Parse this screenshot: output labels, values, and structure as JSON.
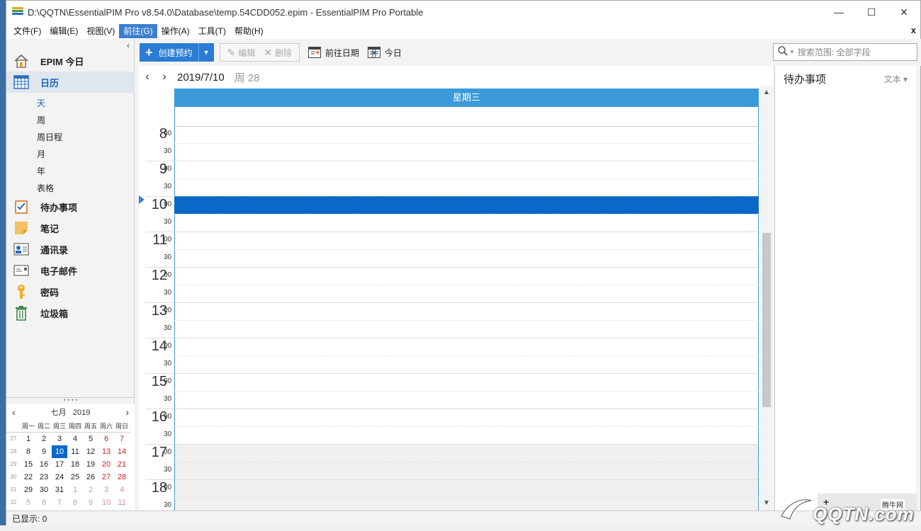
{
  "window": {
    "title": "D:\\QQTN\\EssentialPIM Pro v8.54.0\\Database\\temp.54CDD052.epim - EssentialPIM Pro Portable",
    "minimize": "—",
    "maximize": "☐",
    "close": "✕"
  },
  "menubar": {
    "items": [
      "文件(F)",
      "编辑(E)",
      "视图(V)",
      "前往(G)",
      "操作(A)",
      "工具(T)",
      "帮助(H)"
    ],
    "active_index": 3,
    "close": "x"
  },
  "sidebar": {
    "collapse": "‹",
    "today_label": "EPIM 今日",
    "calendar_label": "日历",
    "views": [
      "天",
      "周",
      "周日程",
      "月",
      "年",
      "表格"
    ],
    "todo_label": "待办事项",
    "notes_label": "笔记",
    "contacts_label": "通讯录",
    "email_label": "电子邮件",
    "password_label": "密码",
    "trash_label": "垃圾箱",
    "splitter_dots": "• • • •"
  },
  "minical": {
    "prev": "‹",
    "next": "›",
    "month": "七月",
    "year": "2019",
    "dow": [
      "周一",
      "周二",
      "周三",
      "周四",
      "周五",
      "周六",
      "周日"
    ],
    "weeks": [
      {
        "wk": "27",
        "days": [
          "1",
          "2",
          "3",
          "4",
          "5",
          "6",
          "7"
        ]
      },
      {
        "wk": "28",
        "days": [
          "8",
          "9",
          "10",
          "11",
          "12",
          "13",
          "14"
        ]
      },
      {
        "wk": "29",
        "days": [
          "15",
          "16",
          "17",
          "18",
          "19",
          "20",
          "21"
        ]
      },
      {
        "wk": "30",
        "days": [
          "22",
          "23",
          "24",
          "25",
          "26",
          "27",
          "28"
        ]
      },
      {
        "wk": "31",
        "days": [
          "29",
          "30",
          "31",
          "1",
          "2",
          "3",
          "4"
        ]
      },
      {
        "wk": "32",
        "days": [
          "5",
          "6",
          "7",
          "8",
          "9",
          "10",
          "11"
        ]
      }
    ],
    "selected_day": "10"
  },
  "toolbar": {
    "create_label": "创建预约",
    "edit_label": "编辑",
    "delete_label": "删除",
    "goto_date_label": "前往日期",
    "today_label": "今日",
    "search_placeholder": "搜索范围: 全部字段"
  },
  "calendar": {
    "prev": "‹",
    "next": "›",
    "date": "2019/7/10",
    "week": "周 28",
    "day_header": "星期三",
    "hours": [
      "8",
      "9",
      "10",
      "11",
      "12",
      "13",
      "14",
      "15",
      "16",
      "17",
      "18"
    ],
    "min00": "00",
    "min30": "30"
  },
  "todo_panel": {
    "title": "待办事项",
    "sort_label": "文本 ▾"
  },
  "status": {
    "shown": "已显示: 0"
  },
  "watermark": {
    "brand": "QQTN.com",
    "badge": "腾牛网"
  },
  "colors": {
    "accent": "#3a9ad9",
    "selection": "#0a68c8",
    "weekend": "#d02020"
  }
}
